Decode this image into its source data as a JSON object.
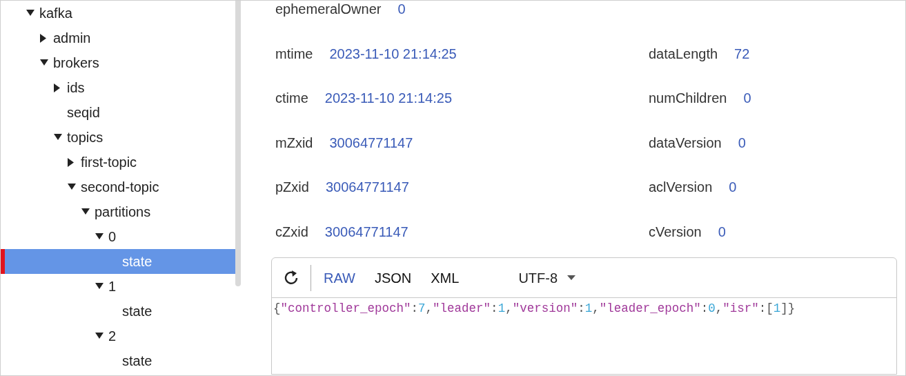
{
  "tree": [
    {
      "label": "kafka",
      "expanded": true,
      "selected": false,
      "children": [
        {
          "label": "admin",
          "expanded": false,
          "selected": false
        },
        {
          "label": "brokers",
          "expanded": true,
          "selected": false,
          "children": [
            {
              "label": "ids",
              "expanded": false,
              "selected": false
            },
            {
              "label": "seqid",
              "selected": false
            },
            {
              "label": "topics",
              "expanded": true,
              "selected": false,
              "children": [
                {
                  "label": "first-topic",
                  "expanded": false,
                  "selected": false
                },
                {
                  "label": "second-topic",
                  "expanded": true,
                  "selected": false,
                  "children": [
                    {
                      "label": "partitions",
                      "expanded": true,
                      "selected": false,
                      "children": [
                        {
                          "label": "0",
                          "expanded": true,
                          "selected": false,
                          "children": [
                            {
                              "label": "state",
                              "selected": true
                            }
                          ]
                        },
                        {
                          "label": "1",
                          "expanded": true,
                          "selected": false,
                          "children": [
                            {
                              "label": "state",
                              "selected": false
                            }
                          ]
                        },
                        {
                          "label": "2",
                          "expanded": true,
                          "selected": false,
                          "children": [
                            {
                              "label": "state",
                              "selected": false
                            }
                          ]
                        }
                      ]
                    }
                  ]
                }
              ]
            }
          ]
        }
      ]
    }
  ],
  "stat_rows": [
    {
      "left": {
        "label": "ephemeralOwner",
        "value": "0"
      }
    },
    {
      "left": {
        "label": "mtime",
        "value": "2023-11-10 21:14:25"
      },
      "right": {
        "label": "dataLength",
        "value": "72"
      }
    },
    {
      "left": {
        "label": "ctime",
        "value": "2023-11-10 21:14:25"
      },
      "right": {
        "label": "numChildren",
        "value": "0"
      }
    },
    {
      "left": {
        "label": "mZxid",
        "value": "30064771147"
      },
      "right": {
        "label": "dataVersion",
        "value": "0"
      }
    },
    {
      "left": {
        "label": "pZxid",
        "value": "30064771147"
      },
      "right": {
        "label": "aclVersion",
        "value": "0"
      }
    },
    {
      "left": {
        "label": "cZxid",
        "value": "30064771147"
      },
      "right": {
        "label": "cVersion",
        "value": "0"
      }
    }
  ],
  "editor": {
    "formats": [
      {
        "label": "RAW",
        "selected": true
      },
      {
        "label": "JSON",
        "selected": false
      },
      {
        "label": "XML",
        "selected": false
      }
    ],
    "encoding": "UTF-8",
    "code": [
      {
        "kind": "punct",
        "text": "{"
      },
      {
        "kind": "key",
        "text": "\"controller_epoch\""
      },
      {
        "kind": "punct",
        "text": ":"
      },
      {
        "kind": "number",
        "text": "7"
      },
      {
        "kind": "punct",
        "text": ","
      },
      {
        "kind": "key",
        "text": "\"leader\""
      },
      {
        "kind": "punct",
        "text": ":"
      },
      {
        "kind": "number",
        "text": "1"
      },
      {
        "kind": "punct",
        "text": ","
      },
      {
        "kind": "key",
        "text": "\"version\""
      },
      {
        "kind": "punct",
        "text": ":"
      },
      {
        "kind": "number",
        "text": "1"
      },
      {
        "kind": "punct",
        "text": ","
      },
      {
        "kind": "key",
        "text": "\"leader_epoch\""
      },
      {
        "kind": "punct",
        "text": ":"
      },
      {
        "kind": "number",
        "text": "0"
      },
      {
        "kind": "punct",
        "text": ","
      },
      {
        "kind": "key",
        "text": "\"isr\""
      },
      {
        "kind": "punct",
        "text": ":["
      },
      {
        "kind": "number",
        "text": "1"
      },
      {
        "kind": "punct",
        "text": "]}"
      }
    ]
  }
}
